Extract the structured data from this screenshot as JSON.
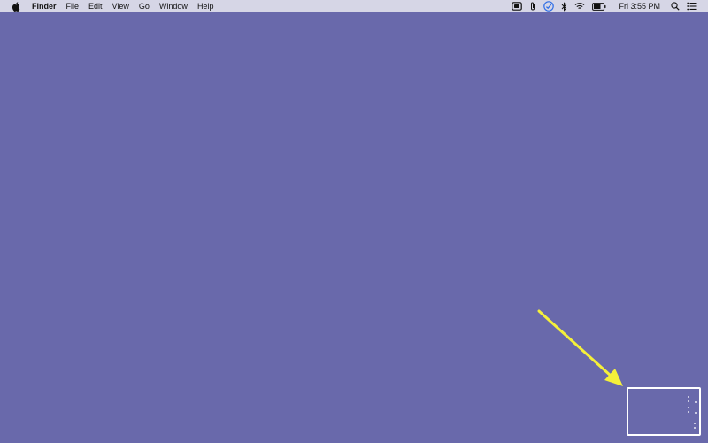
{
  "menubar": {
    "app_name": "Finder",
    "menus": [
      "File",
      "Edit",
      "View",
      "Go",
      "Window",
      "Help"
    ],
    "status_icons": [
      "airplay-icon",
      "attachment-icon",
      "time-machine-icon",
      "bluetooth-icon",
      "wifi-icon",
      "battery-icon"
    ],
    "clock": "Fri 3:55 PM"
  },
  "colors": {
    "desktop": "#6969ab",
    "menubar": "#d6d6e6",
    "arrow": "#f5f03a",
    "thumbnail_border": "#ffffff"
  }
}
